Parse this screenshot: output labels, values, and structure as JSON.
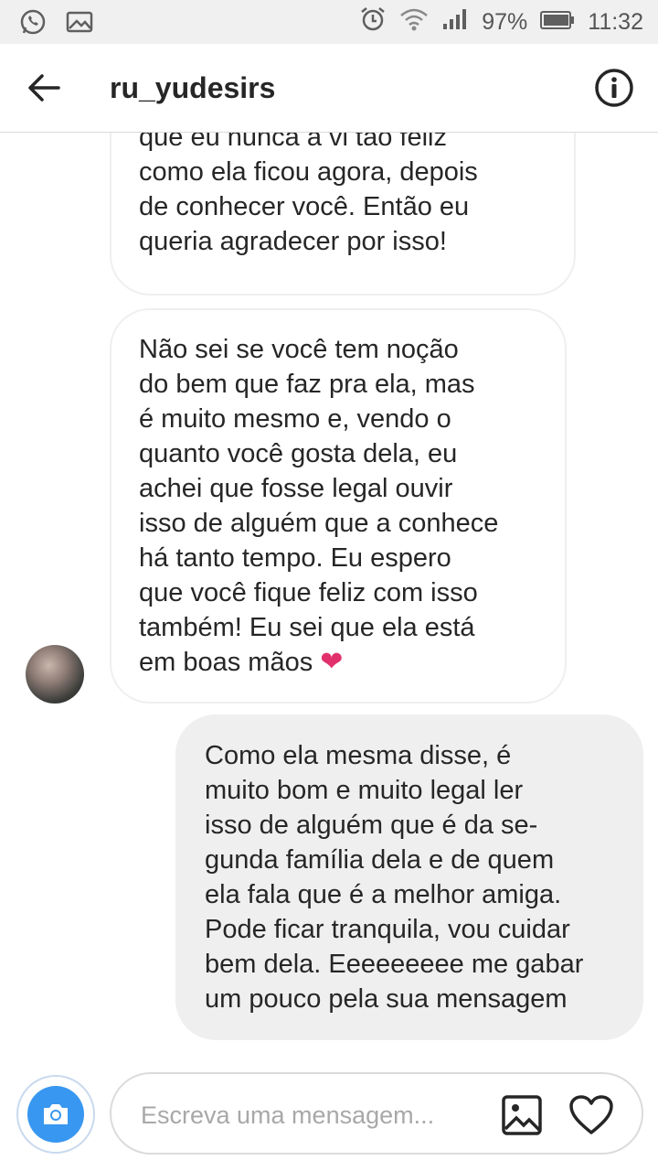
{
  "status_bar": {
    "battery_percent": "97%",
    "time": "11:32",
    "icons": [
      "whatsapp-icon",
      "image-icon",
      "alarm-icon",
      "wifi-icon",
      "signal-icon",
      "battery-icon"
    ]
  },
  "header": {
    "title": "ru_yudesirs",
    "icons": [
      "back-arrow-icon",
      "info-icon"
    ]
  },
  "messages": [
    {
      "side": "incoming",
      "text": "que eu nunca a vi tão feliz\ncomo ela ficou agora, depois\nde conhecer você. Então eu\nqueria agradecer por isso!"
    },
    {
      "side": "incoming",
      "text": "Não sei se você tem noção\ndo bem que faz pra ela, mas\né muito mesmo e, vendo o\nquanto você gosta dela, eu\nachei que fosse legal ouvir\nisso de alguém que a conhece\nhá tanto tempo. Eu espero\nque você fique feliz com isso\ntambém! Eu sei que ela está\nem boas mãos ",
      "emoji": "❤"
    },
    {
      "side": "outgoing",
      "text": "Como ela mesma disse, é\nmuito bom e muito legal ler\nisso de alguém que é da se-\ngunda família dela e de quem\nela fala que é a melhor amiga.\nPode ficar tranquila, vou cuidar\nbem dela. Eeeeeeeee me gabar\num pouco pela sua mensagem"
    }
  ],
  "composer": {
    "placeholder": "Escreva uma mensagem...",
    "value": "",
    "icons": [
      "camera-icon",
      "gallery-icon",
      "heart-icon"
    ]
  },
  "colors": {
    "accent": "#3897f0",
    "heart": "#e1306c",
    "outgoing_bubble": "#efefef"
  }
}
